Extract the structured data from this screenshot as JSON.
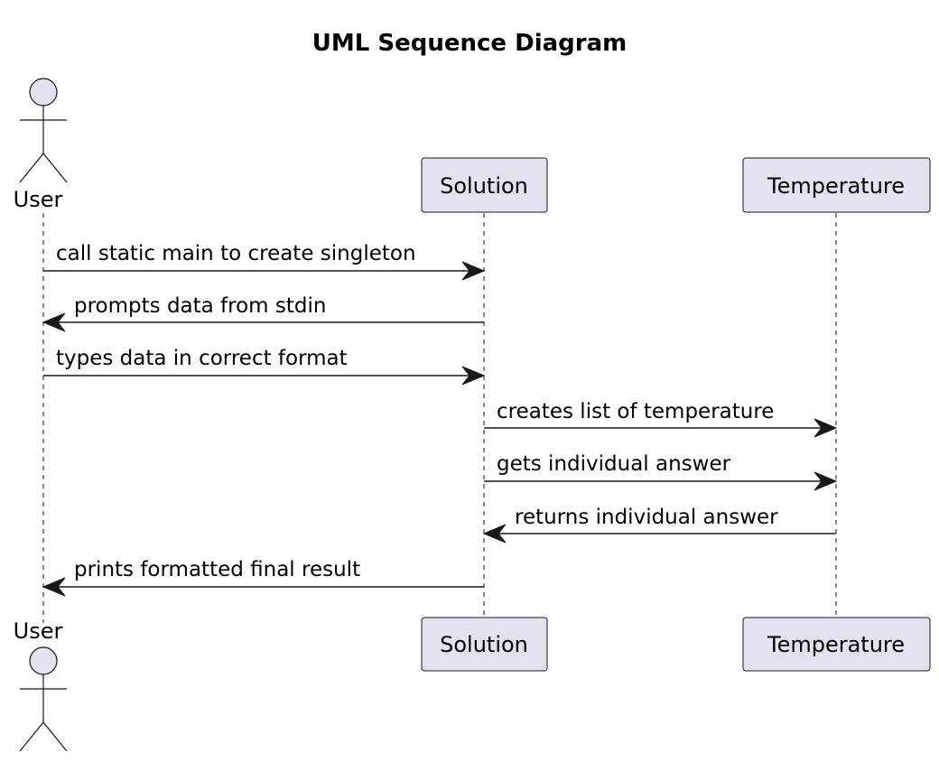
{
  "diagram": {
    "title": "UML Sequence Diagram",
    "participants": [
      {
        "id": "user",
        "label": "User",
        "kind": "actor"
      },
      {
        "id": "solution",
        "label": "Solution",
        "kind": "participant"
      },
      {
        "id": "temperature",
        "label": "Temperature",
        "kind": "participant"
      }
    ],
    "messages": [
      {
        "from": "user",
        "to": "solution",
        "text": "call static main to create singleton"
      },
      {
        "from": "solution",
        "to": "user",
        "text": "prompts data from stdin"
      },
      {
        "from": "user",
        "to": "solution",
        "text": "types data in correct format"
      },
      {
        "from": "solution",
        "to": "temperature",
        "text": "creates list of temperature"
      },
      {
        "from": "solution",
        "to": "temperature",
        "text": "gets individual answer"
      },
      {
        "from": "temperature",
        "to": "solution",
        "text": "returns individual answer"
      },
      {
        "from": "solution",
        "to": "user",
        "text": "prints formatted final result"
      }
    ]
  }
}
